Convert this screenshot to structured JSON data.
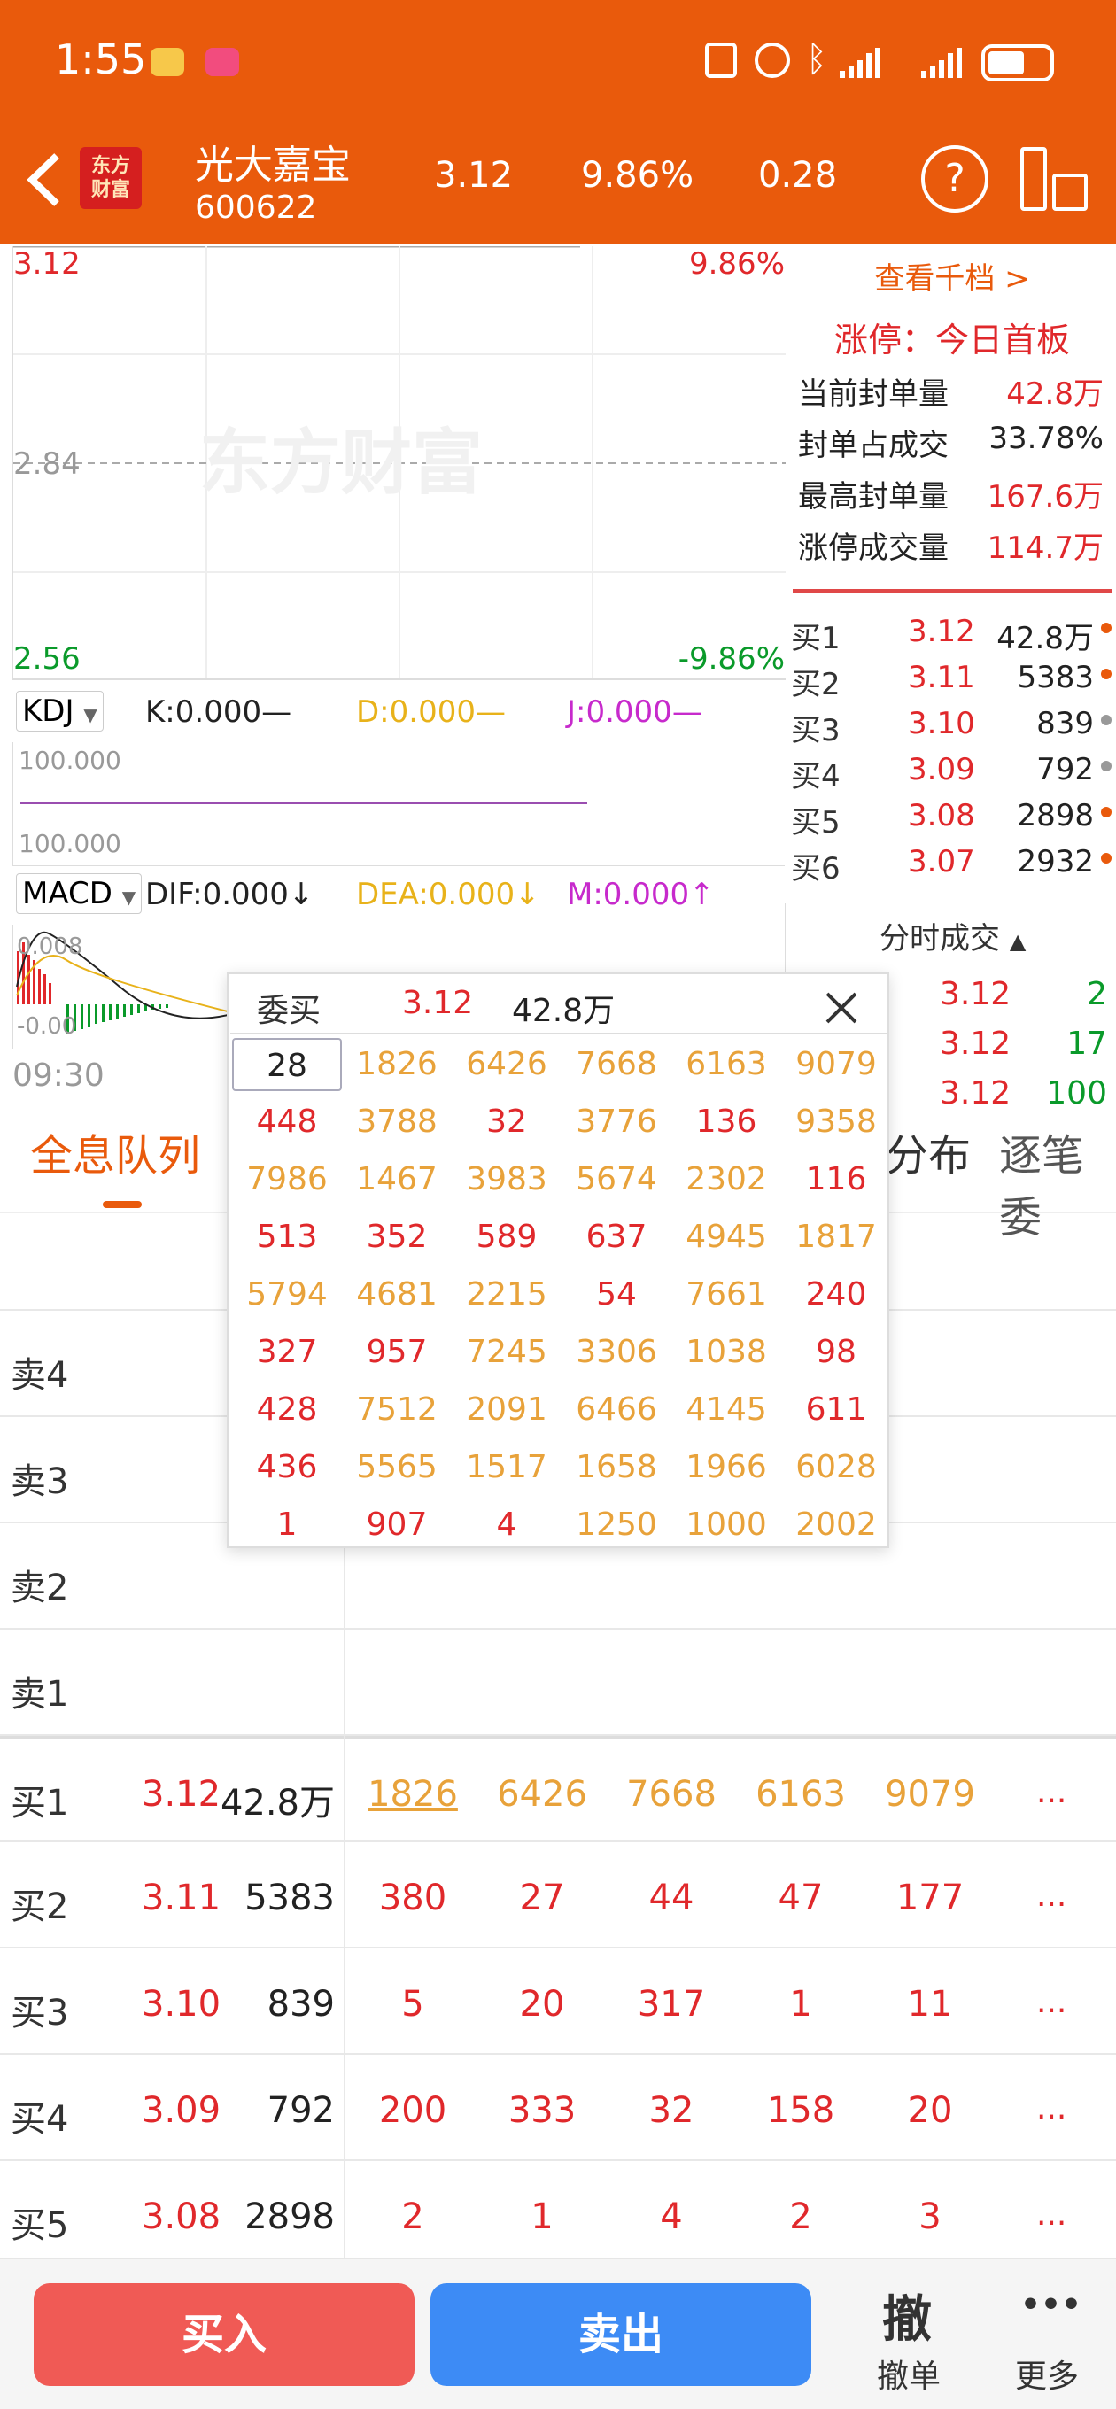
{
  "status": {
    "time": "1:55"
  },
  "header": {
    "name": "光大嘉宝",
    "code": "600622",
    "price": "3.12",
    "pct": "9.86%",
    "change": "0.28",
    "logo_text": "东方\n财富",
    "help": "?"
  },
  "chart": {
    "top_price": "3.12",
    "top_pct": "9.86%",
    "mid_price": "2.84",
    "bottom_price": "2.56",
    "bottom_pct": "-9.86%",
    "time_start": "09:30",
    "watermark": "东方财富"
  },
  "kdj": {
    "select": "KDJ",
    "k": "K:0.000—",
    "d": "D:0.000—",
    "j": "J:0.000—",
    "top": "100.000",
    "bottom": "100.000"
  },
  "macd": {
    "select": "MACD",
    "dif": "DIF:0.000↓",
    "dea": "DEA:0.000↓",
    "m": "M:0.000↑",
    "top": "0.008",
    "bottom": "-0.00"
  },
  "right_panel": {
    "link": "查看千档 >",
    "limit_title": "涨停：今日首板",
    "stats": [
      {
        "label": "当前封单量",
        "value": "42.8万"
      },
      {
        "label": "封单占成交",
        "value": "33.78%"
      },
      {
        "label": "最高封单量",
        "value": "167.6万"
      },
      {
        "label": "涨停成交量",
        "value": "114.7万"
      }
    ],
    "orders": [
      {
        "label": "买1",
        "price": "3.12",
        "vol": "42.8万",
        "dot": "#E95A0C"
      },
      {
        "label": "买2",
        "price": "3.11",
        "vol": "5383",
        "dot": "#E95A0C"
      },
      {
        "label": "买3",
        "price": "3.10",
        "vol": "839",
        "dot": "#999999"
      },
      {
        "label": "买4",
        "price": "3.09",
        "vol": "792",
        "dot": "#999999"
      },
      {
        "label": "买5",
        "price": "3.08",
        "vol": "2898",
        "dot": "#E95A0C"
      },
      {
        "label": "买6",
        "price": "3.07",
        "vol": "2932",
        "dot": "#E95A0C"
      }
    ],
    "ticks_title": "分时成交",
    "ticks": [
      {
        "price": "3.12",
        "vol": "2"
      },
      {
        "price": "3.12",
        "vol": "17"
      },
      {
        "price": "3.12",
        "vol": "100"
      }
    ]
  },
  "tabs": [
    {
      "label": "全息队列"
    },
    {
      "label": "分布"
    },
    {
      "label": "逐笔委"
    }
  ],
  "popup": {
    "title": "委买",
    "price": "3.12",
    "vol": "42.8万",
    "grid": [
      [
        "28",
        "1826",
        "6426",
        "7668",
        "6163",
        "9079"
      ],
      [
        "448",
        "3788",
        "32",
        "3776",
        "136",
        "9358"
      ],
      [
        "7986",
        "1467",
        "3983",
        "5674",
        "2302",
        "116"
      ],
      [
        "513",
        "352",
        "589",
        "637",
        "4945",
        "1817"
      ],
      [
        "5794",
        "4681",
        "2215",
        "54",
        "7661",
        "240"
      ],
      [
        "327",
        "957",
        "7245",
        "3306",
        "1038",
        "98"
      ],
      [
        "428",
        "7512",
        "2091",
        "6466",
        "4145",
        "611"
      ],
      [
        "436",
        "5565",
        "1517",
        "1658",
        "1966",
        "6028"
      ],
      [
        "1",
        "907",
        "4",
        "1250",
        "1000",
        "2002"
      ]
    ]
  },
  "sell_rows": [
    {
      "label": "卖4"
    },
    {
      "label": "卖3"
    },
    {
      "label": "卖2"
    },
    {
      "label": "卖1"
    }
  ],
  "buy_rows": [
    {
      "label": "买1",
      "price": "3.12",
      "vol": "42.8万",
      "q": [
        "1826",
        "6426",
        "7668",
        "6163",
        "9079"
      ],
      "more": "..."
    },
    {
      "label": "买2",
      "price": "3.11",
      "vol": "5383",
      "q": [
        "380",
        "27",
        "44",
        "47",
        "177"
      ],
      "more": "..."
    },
    {
      "label": "买3",
      "price": "3.10",
      "vol": "839",
      "q": [
        "5",
        "20",
        "317",
        "1",
        "11"
      ],
      "more": "..."
    },
    {
      "label": "买4",
      "price": "3.09",
      "vol": "792",
      "q": [
        "200",
        "333",
        "32",
        "158",
        "20"
      ],
      "more": "..."
    },
    {
      "label": "买5",
      "price": "3.08",
      "vol": "2898",
      "q": [
        "2",
        "1",
        "4",
        "2",
        "3"
      ],
      "more": "..."
    }
  ],
  "bottom": {
    "buy": "买入",
    "sell": "卖出",
    "cancel_icon": "撤",
    "cancel": "撤单",
    "more_icon": "•••",
    "more": "更多"
  },
  "colors": {
    "brand": "#E95A0C",
    "up": "#E0282B",
    "down": "#0A9A2A",
    "amber": "#E8A23A",
    "buy_btn": "#F05A55",
    "sell_btn": "#3D8BF5"
  }
}
